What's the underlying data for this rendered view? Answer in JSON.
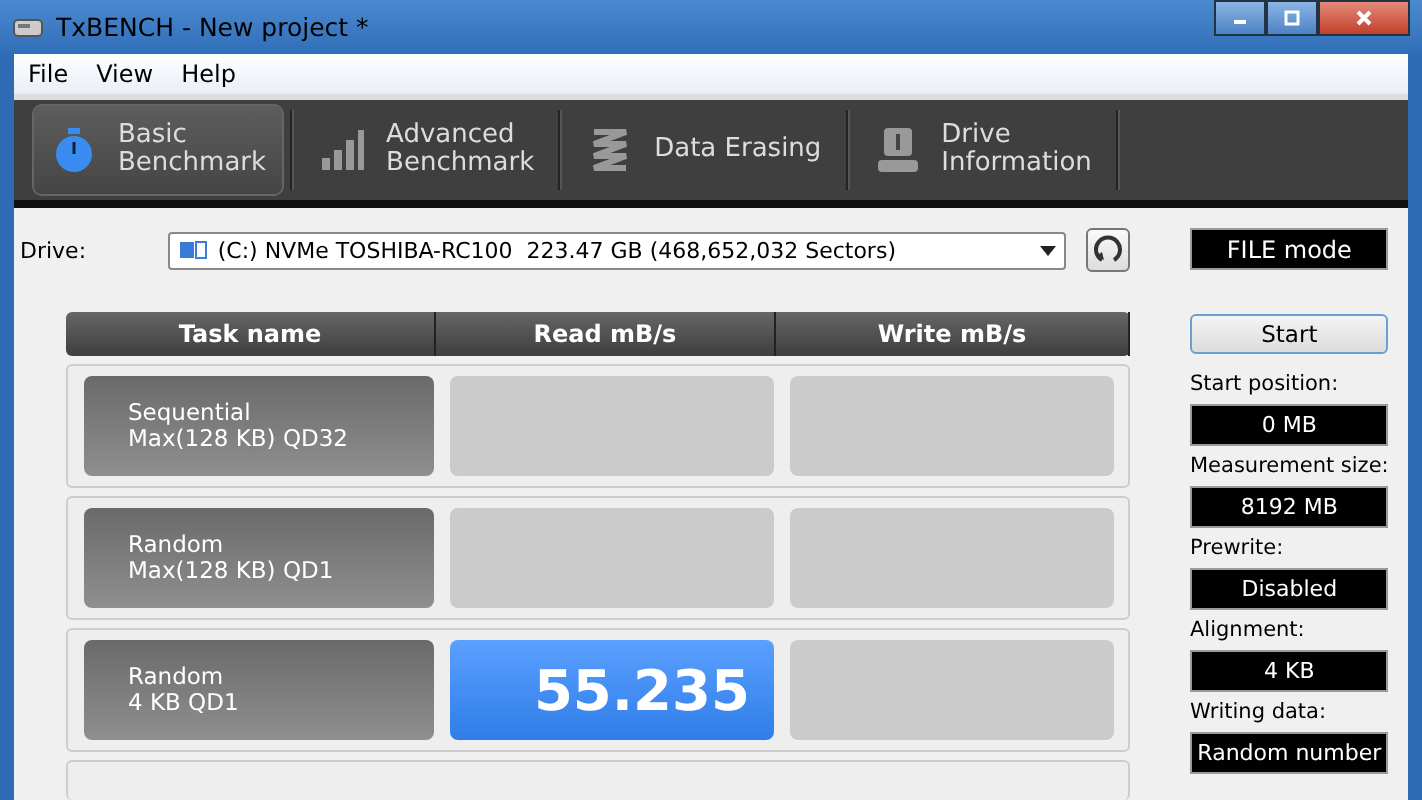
{
  "window": {
    "title": "TxBENCH - New project *"
  },
  "menu": [
    "File",
    "View",
    "Help"
  ],
  "tabs": [
    {
      "lines": [
        "Basic",
        "Benchmark"
      ],
      "selected": true
    },
    {
      "lines": [
        "Advanced",
        "Benchmark"
      ],
      "selected": false
    },
    {
      "lines": [
        "Data Erasing"
      ],
      "selected": false
    },
    {
      "lines": [
        "Drive",
        "Information"
      ],
      "selected": false
    }
  ],
  "drive": {
    "label": "Drive:",
    "value": "(C:) NVMe TOSHIBA-RC100  223.47 GB (468,652,032 Sectors)"
  },
  "mode": "FILE mode",
  "table": {
    "columns": [
      "Task name",
      "Read mB/s",
      "Write mB/s"
    ],
    "rows": [
      {
        "lines": [
          "Sequential",
          "Max(128 KB) QD32"
        ]
      },
      {
        "lines": [
          "Random",
          "Max(128 KB) QD1"
        ]
      },
      {
        "lines": [
          "Random",
          "4 KB QD1"
        ],
        "read": "55.235"
      }
    ]
  },
  "start_button": "Start",
  "settings": [
    {
      "label": "Start position:",
      "value": "0 MB"
    },
    {
      "label": "Measurement size:",
      "value": "8192 MB"
    },
    {
      "label": "Prewrite:",
      "value": "Disabled"
    },
    {
      "label": "Alignment:",
      "value": "4 KB"
    },
    {
      "label": "Writing data:",
      "value": "Random number"
    }
  ]
}
